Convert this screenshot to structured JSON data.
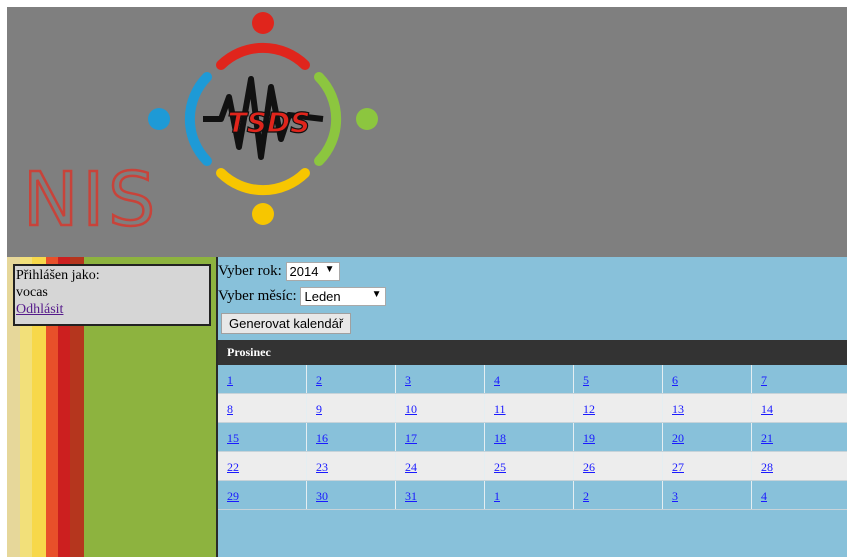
{
  "login": {
    "label": "Přihlášen jako:",
    "username": "vocas",
    "logout": "Odhlásit"
  },
  "form": {
    "year_label": "Vyber rok:",
    "year_value": "2014",
    "month_label": "Vyber měsíc:",
    "month_value": "Leden",
    "generate_button": "Generovat kalendář"
  },
  "calendar": {
    "title": "Prosinec",
    "weeks": [
      [
        "1",
        "2",
        "3",
        "4",
        "5",
        "6",
        "7"
      ],
      [
        "8",
        "9",
        "10",
        "11",
        "12",
        "13",
        "14"
      ],
      [
        "15",
        "16",
        "17",
        "18",
        "19",
        "20",
        "21"
      ],
      [
        "22",
        "23",
        "24",
        "25",
        "26",
        "27",
        "28"
      ],
      [
        "29",
        "30",
        "31",
        "1",
        "2",
        "3",
        "4"
      ]
    ]
  },
  "logo": {
    "text_main": "NIS",
    "text_badge": "TSDS"
  },
  "colors": {
    "header_bg": "#7f7f7f",
    "sidebar_bg": "#8db33f",
    "main_bg": "#88c1da",
    "cal_header_bg": "#333333",
    "logo_red": "#e0251c",
    "logo_blue": "#1e9ad6",
    "logo_green": "#8cc63f",
    "logo_yellow": "#f7c600"
  },
  "icons": [
    "logo-people-circle-icon",
    "dropdown-arrow-icon"
  ]
}
